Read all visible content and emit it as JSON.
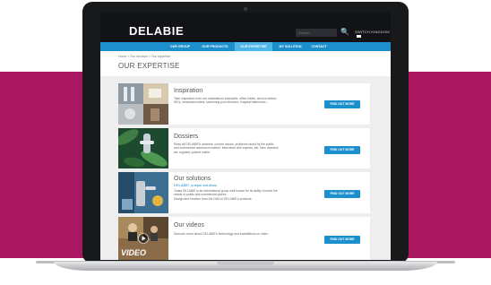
{
  "brand": {
    "logo": "DELABIE"
  },
  "topbar": {
    "search_placeholder": "Search",
    "language": "SWITCH KINGDOM"
  },
  "nav": {
    "items": [
      {
        "label": "OUR GROUP",
        "active": false
      },
      {
        "label": "OUR PRODUCTS",
        "active": false
      },
      {
        "label": "OUR EXPERTISE",
        "active": true
      },
      {
        "label": "MY SOLUTION",
        "active": false
      },
      {
        "label": "CONTACT",
        "active": false
      }
    ]
  },
  "breadcrumb": "Home  >  Our services  >  Our expertise",
  "page": {
    "title": "OUR EXPERTISE"
  },
  "cards": [
    {
      "title": "Inspiration",
      "subtitle": "",
      "description": "Take inspiration from our installations examples: office toilets, service station WCs, restaurant toilets, swimming pool showers, hospital bathrooms...",
      "button": "FIND OUT MORE"
    },
    {
      "title": "Dossiers",
      "subtitle": "",
      "description": "Read all DELABIE's dossiers: current issues, problems faced by the public and commercial washroom market, interviews with experts, etc. New dossiers are regularly posted online.",
      "button": "FIND OUT MORE"
    },
    {
      "title": "Our solutions",
      "subtitle": "DELABIE, unique solutions",
      "description": "Today DELABIE is an international group well known for its ability to meet the needs of public and commercial places.\nDesign and function form the DNA of DELABIE's products.",
      "button": "FIND OUT MORE"
    },
    {
      "title": "Our videos",
      "subtitle": "",
      "description": "Discover more about DELABIE's technology and installations on video.",
      "button": "FIND OUT MORE",
      "image_text": "VIDEO"
    }
  ],
  "colors": {
    "magenta_band": "#a8175f",
    "nav_blue": "#1d8fcd",
    "nav_active": "#4db6ea",
    "topbar": "#121316"
  },
  "icons": [
    "search-icon",
    "flag-icon",
    "play-icon"
  ]
}
